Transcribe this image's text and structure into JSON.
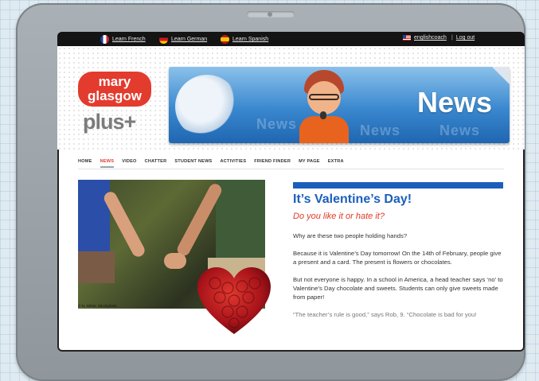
{
  "topbar": {
    "languages": [
      {
        "label": "Learn French",
        "flag": "french-flag-icon"
      },
      {
        "label": "Learn German",
        "flag": "german-flag-icon"
      },
      {
        "label": "Learn Spanish",
        "flag": "spanish-flag-icon"
      }
    ],
    "account_label": "englishcoach",
    "logout_label": "Log out",
    "separator": "|"
  },
  "logo": {
    "brand_line1": "mary",
    "brand_line2": "glasgow",
    "plus": "plus+"
  },
  "banner": {
    "title": "News",
    "ghost_text": "News"
  },
  "nav": {
    "items": [
      {
        "label": "HOME"
      },
      {
        "label": "NEWS",
        "active": true
      },
      {
        "label": "VIDEO"
      },
      {
        "label": "CHATTER"
      },
      {
        "label": "STUDENT NEWS"
      },
      {
        "label": "ACTIVITIES"
      },
      {
        "label": "FRIEND FINDER"
      },
      {
        "label": "MY PAGE"
      },
      {
        "label": "EXTRA"
      }
    ]
  },
  "photo": {
    "caption": "© N. White; iStockphoto"
  },
  "article": {
    "title": "It’s Valentine’s Day!",
    "subtitle": "Do you like it or hate it?",
    "paragraphs": [
      "Why are these two people holding hands?",
      "Because it is Valentine’s Day tomorrow! On the 14th of February, people give a present and a card. The present is flowers or chocolates.",
      "But not everyone is happy. In a school in America, a head teacher says ‘no’ to Valentine’s Day chocolate and sweets. Students can only give sweets made from paper!",
      "“The teacher’s rule is good,” says Rob, 9. “Chocolate is bad for you!"
    ]
  },
  "colors": {
    "accent_blue": "#1a5fbc",
    "accent_red": "#e03a24",
    "logo_red": "#e33b2e"
  }
}
